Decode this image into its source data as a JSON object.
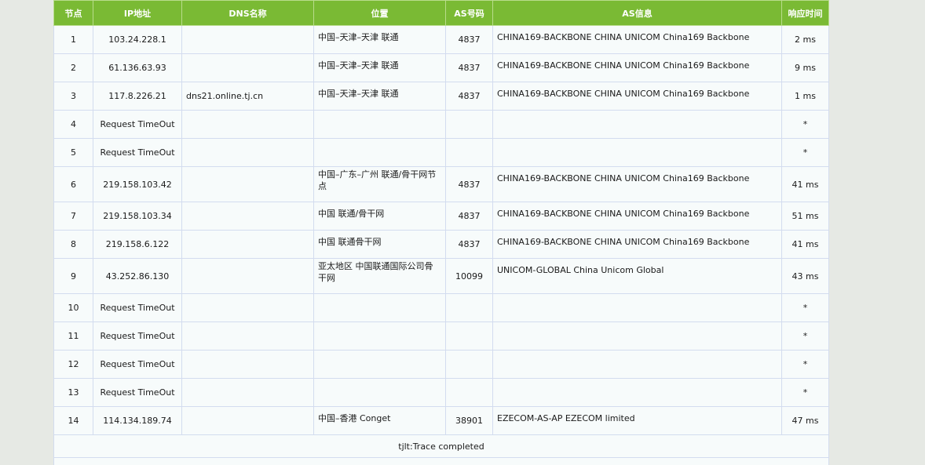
{
  "headers": [
    "节点",
    "IP地址",
    "DNS名称",
    "位置",
    "AS号码",
    "AS信息",
    "响应时间"
  ],
  "rows": [
    {
      "hop": "1",
      "ip": "103.24.228.1",
      "dns": "",
      "loc": "中国–天津–天津 联通",
      "asn": "4837",
      "asinfo": "CHINA169-BACKBONE CHINA UNICOM China169 Backbone",
      "time": "2 ms",
      "h": "r29"
    },
    {
      "hop": "2",
      "ip": "61.136.63.93",
      "dns": "",
      "loc": "中国–天津–天津 联通",
      "asn": "4837",
      "asinfo": "CHINA169-BACKBONE CHINA UNICOM China169 Backbone",
      "time": "9 ms",
      "h": "r29"
    },
    {
      "hop": "3",
      "ip": "117.8.226.21",
      "dns": "dns21.online.tj.cn",
      "loc": "中国–天津–天津 联通",
      "asn": "4837",
      "asinfo": "CHINA169-BACKBONE CHINA UNICOM China169 Backbone",
      "time": "1 ms",
      "h": "r29"
    },
    {
      "hop": "4",
      "ip": "Request TimeOut",
      "dns": "",
      "loc": "",
      "asn": "",
      "asinfo": "",
      "time": "*",
      "h": "r29"
    },
    {
      "hop": "5",
      "ip": "Request TimeOut",
      "dns": "",
      "loc": "",
      "asn": "",
      "asinfo": "",
      "time": "*",
      "h": "r29"
    },
    {
      "hop": "6",
      "ip": "219.158.103.42",
      "dns": "",
      "loc": "中国–广东–广州 联通/骨干网节点",
      "asn": "4837",
      "asinfo": "CHINA169-BACKBONE CHINA UNICOM China169 Backbone",
      "time": "41 ms",
      "h": "r38"
    },
    {
      "hop": "7",
      "ip": "219.158.103.34",
      "dns": "",
      "loc": "中国 联通/骨干网",
      "asn": "4837",
      "asinfo": "CHINA169-BACKBONE CHINA UNICOM China169 Backbone",
      "time": "51 ms",
      "h": "r29"
    },
    {
      "hop": "8",
      "ip": "219.158.6.122",
      "dns": "",
      "loc": "中国 联通骨干网",
      "asn": "4837",
      "asinfo": "CHINA169-BACKBONE CHINA UNICOM China169 Backbone",
      "time": "41 ms",
      "h": "r29"
    },
    {
      "hop": "9",
      "ip": "43.252.86.130",
      "dns": "",
      "loc": "亚太地区 中国联通国际公司骨干网",
      "asn": "10099",
      "asinfo": "UNICOM-GLOBAL China Unicom Global",
      "time": "43 ms",
      "h": "r38"
    },
    {
      "hop": "10",
      "ip": "Request TimeOut",
      "dns": "",
      "loc": "",
      "asn": "",
      "asinfo": "",
      "time": "*",
      "h": "r29"
    },
    {
      "hop": "11",
      "ip": "Request TimeOut",
      "dns": "",
      "loc": "",
      "asn": "",
      "asinfo": "",
      "time": "*",
      "h": "r29"
    },
    {
      "hop": "12",
      "ip": "Request TimeOut",
      "dns": "",
      "loc": "",
      "asn": "",
      "asinfo": "",
      "time": "*",
      "h": "r29"
    },
    {
      "hop": "13",
      "ip": "Request TimeOut",
      "dns": "",
      "loc": "",
      "asn": "",
      "asinfo": "",
      "time": "*",
      "h": "r29"
    },
    {
      "hop": "14",
      "ip": "114.134.189.74",
      "dns": "",
      "loc": "中国–香港 Conget",
      "asn": "38901",
      "asinfo": "EZECOM-AS-AP EZECOM limited",
      "time": "47 ms",
      "h": "r29"
    }
  ],
  "footer": "tjlt:Trace completed"
}
